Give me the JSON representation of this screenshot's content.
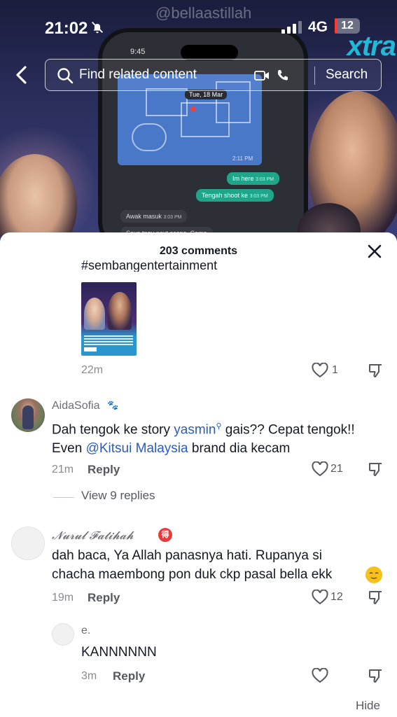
{
  "status_bar": {
    "time": "21:02",
    "network": "4G",
    "battery": "12",
    "battery_level": 0.12,
    "battery_color": "#ff3b30"
  },
  "video": {
    "watermark": "@bellaastillah",
    "phone_time": "9:45",
    "brand_logo": "xtra",
    "map_date": "Tue, 18 Mar",
    "map_time": "2:11 PM",
    "chat_out_1": "Im here",
    "chat_out_1_time": "3:03 PM",
    "chat_out_2": "Tengah shoot ke",
    "chat_out_2_time": "3:03 PM",
    "chat_in_1": "Awak masuk",
    "chat_in_1_time": "3:03 PM",
    "chat_in_2": "Saya tngu next scene. Come"
  },
  "search": {
    "placeholder": "Find related content",
    "button_label": "Search"
  },
  "comments_sheet": {
    "title": "203 comments",
    "hashtag_partial": "#sembangentertainment",
    "top_comment": {
      "time": "22m",
      "likes": "1"
    },
    "comments": [
      {
        "username": "AidaSofia",
        "text_before": "Dah tengok ke story ",
        "mention_1": "yasmin",
        "text_mid": " gais?? Cepat tengok!! Even ",
        "mention_2": "@Kitsui Malaysia",
        "text_after": " brand dia kecam",
        "time": "21m",
        "reply_label": "Reply",
        "likes": "21",
        "view_replies": "View 9 replies"
      },
      {
        "username": "𝓝𝓾𝓻𝓾𝓵 𝓕𝓪𝓽𝓲𝓱𝓪𝓱",
        "badge": "得",
        "text": "dah baca, Ya Allah panasnya hati. Rupanya si chacha maembong pon duk ckp pasal bella ekk",
        "time": "19m",
        "reply_label": "Reply",
        "likes": "12"
      },
      {
        "username": "e.",
        "text": "KANNNNNN",
        "time": "3m",
        "reply_label": "Reply",
        "likes": ""
      }
    ],
    "hide_label": "Hide"
  },
  "icons": {
    "back": "chevron-left-icon",
    "search": "search-icon",
    "video": "video-camera-icon",
    "phone": "phone-icon",
    "close": "close-icon",
    "like": "heart-icon",
    "dislike": "thumbs-down-icon",
    "mute": "bell-off-icon",
    "emoji": "relieved-face-emoji"
  },
  "colors": {
    "mention": "#2b5db8",
    "text_primary": "#161823",
    "text_secondary": "#8a8b91",
    "brand_logo": "#22b9d8"
  }
}
